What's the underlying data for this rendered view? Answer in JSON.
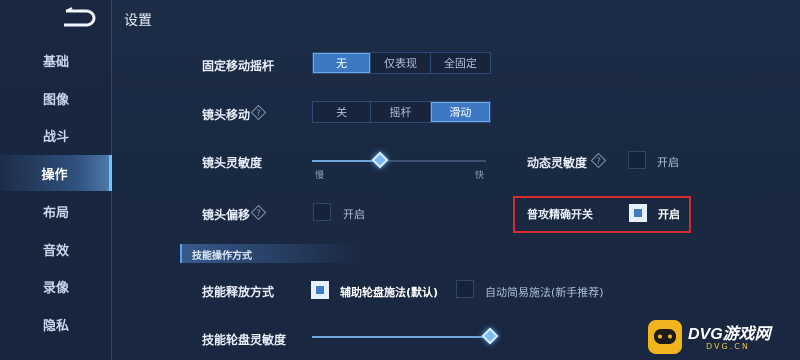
{
  "header": {
    "title": "设置",
    "back_icon": "back-arrow-icon"
  },
  "sidebar": {
    "items": [
      {
        "label": "基础"
      },
      {
        "label": "图像"
      },
      {
        "label": "战斗"
      },
      {
        "label": "操作",
        "active": true
      },
      {
        "label": "布局"
      },
      {
        "label": "音效"
      },
      {
        "label": "录像"
      },
      {
        "label": "隐私"
      }
    ]
  },
  "settings": {
    "joystick": {
      "label": "固定移动摇杆",
      "options": [
        "无",
        "仅表现",
        "全固定"
      ],
      "selected": "无"
    },
    "camera_move": {
      "label": "镜头移动",
      "options": [
        "关",
        "摇杆",
        "滑动"
      ],
      "selected": "滑动",
      "help_icon": "question-icon"
    },
    "camera_sensitivity": {
      "label": "镜头灵敏度",
      "min_label": "慢",
      "max_label": "快",
      "value": 0.45
    },
    "dynamic_sensitivity": {
      "label": "动态灵敏度",
      "toggle_label": "开启",
      "checked": false,
      "help_icon": "question-icon"
    },
    "camera_offset": {
      "label": "镜头偏移",
      "toggle_label": "开启",
      "checked": false,
      "help_icon": "question-icon"
    },
    "precise_attack": {
      "label": "普攻精确开关",
      "toggle_label": "开启",
      "checked": true
    }
  },
  "skill_section": {
    "title": "技能操作方式",
    "release_mode": {
      "label": "技能释放方式",
      "option_a": {
        "label": "辅助轮盘施法(默认)",
        "checked": true
      },
      "option_b": {
        "label": "自动简易施法(新手推荐)",
        "checked": false
      }
    },
    "wheel_sensitivity": {
      "label": "技能轮盘灵敏度",
      "value": 0.8
    }
  },
  "watermark": {
    "brand": "DVG游戏网",
    "url": "DVG.CN"
  },
  "colors": {
    "accent": "#3d79c2",
    "highlight": "#d72a2a",
    "active_nav": "#6fc3ff"
  }
}
